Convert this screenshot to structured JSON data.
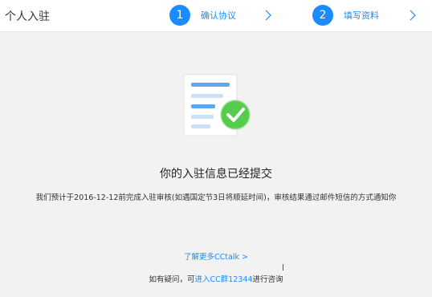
{
  "header": {
    "title": "个人入驻",
    "steps": [
      {
        "number": "1",
        "label": "确认协议"
      },
      {
        "number": "2",
        "label": "填写资料"
      }
    ]
  },
  "main": {
    "title": "你的入驻信息已经提交",
    "description": "我们预计于2016-12-12前完成入驻审核(如遇国定节3日将顺延时间)，审核结果通过邮件短信的方式通知你"
  },
  "footer": {
    "learn_more": "了解更多CCtalk >",
    "help_prefix": "如有疑问，可",
    "help_link": "进入CC群12344",
    "help_suffix": "进行咨询"
  },
  "colors": {
    "accent": "#1a8cff",
    "success": "#4cc84c",
    "background": "#f2f2f2"
  }
}
